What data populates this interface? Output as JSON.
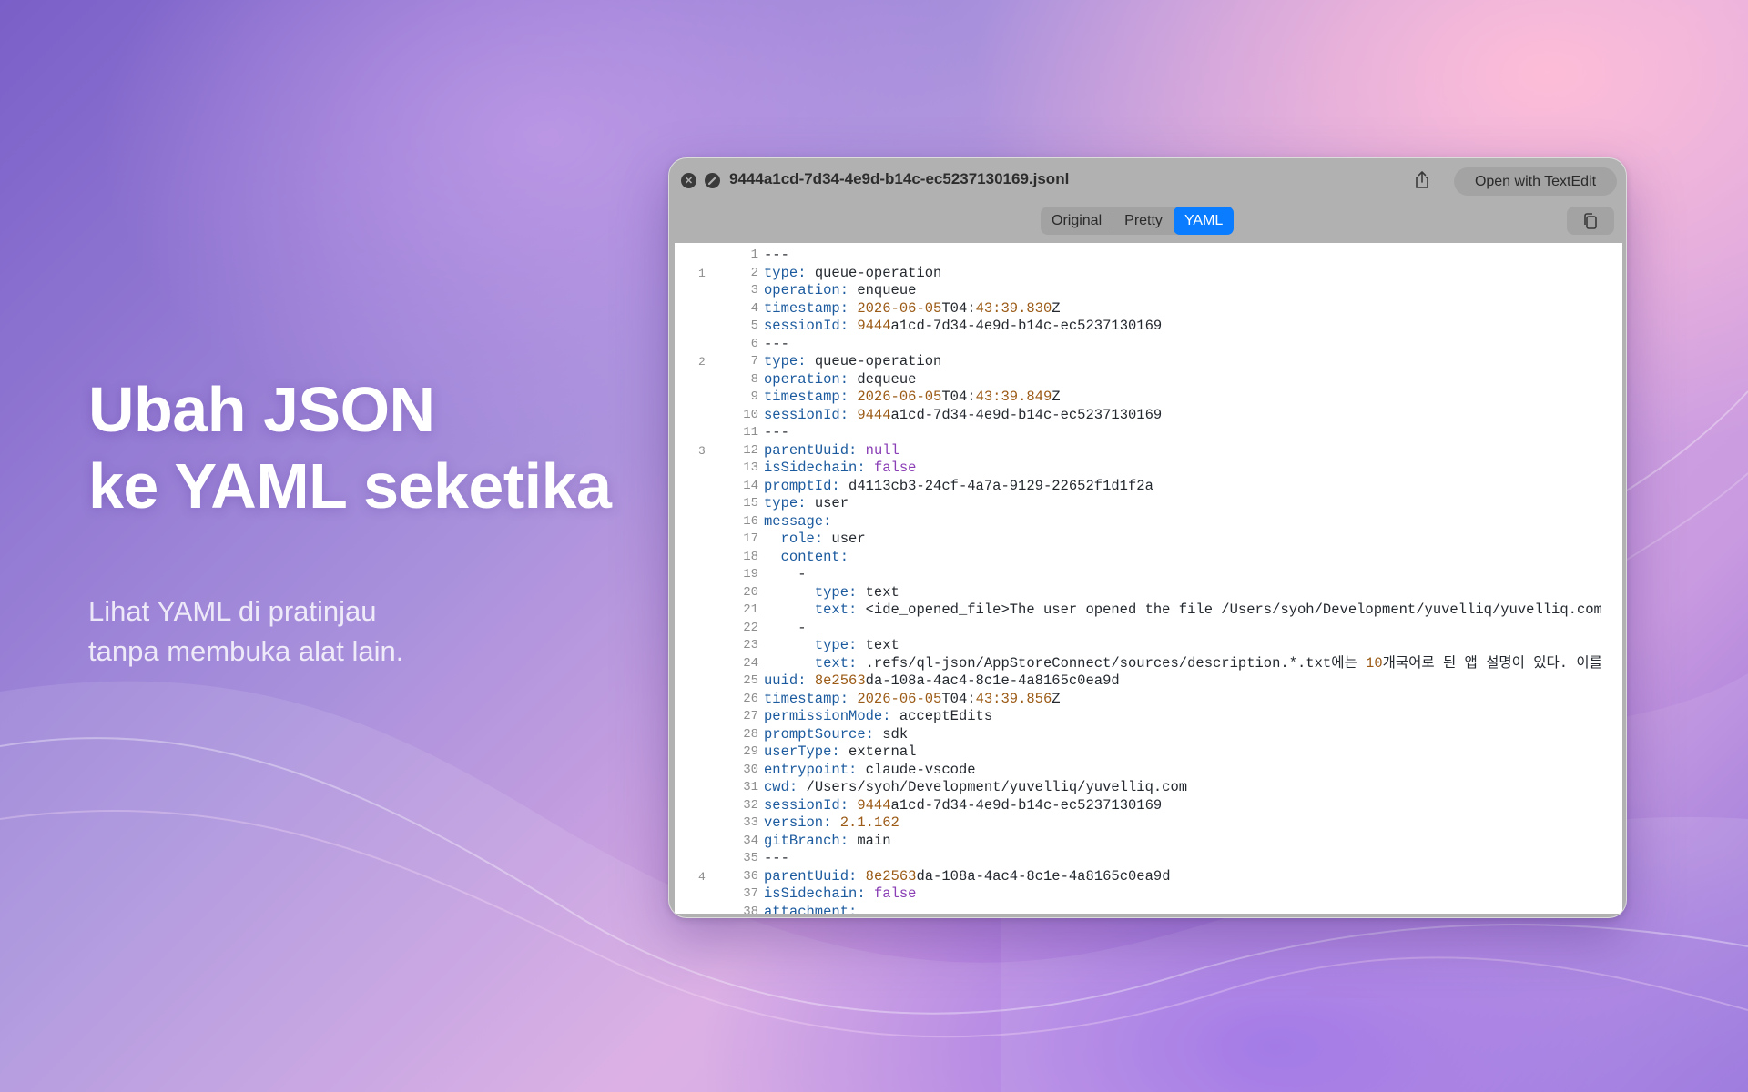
{
  "hero": {
    "title_line1": "Ubah JSON",
    "title_line2": "ke YAML seketika",
    "sub_line1": "Lihat YAML di pratinjau",
    "sub_line2": "tanpa membuka alat lain."
  },
  "window": {
    "filename": "9444a1cd-7d34-4e9d-b14c-ec5237130169.jsonl",
    "open_button": "Open with TextEdit",
    "tabs": [
      "Original",
      "Pretty",
      "YAML"
    ],
    "active_tab": "YAML"
  },
  "editor": {
    "lines": [
      {
        "n": "1",
        "rec": "",
        "t": [
          [
            "",
            "---"
          ]
        ]
      },
      {
        "n": "2",
        "rec": "1",
        "t": [
          [
            "k",
            "type:"
          ],
          [
            "",
            " queue-operation"
          ]
        ]
      },
      {
        "n": "3",
        "rec": "",
        "t": [
          [
            "k",
            "operation:"
          ],
          [
            "",
            " enqueue"
          ]
        ]
      },
      {
        "n": "4",
        "rec": "",
        "t": [
          [
            "k",
            "timestamp:"
          ],
          [
            "",
            " "
          ],
          [
            "n",
            "2026-06-05"
          ],
          [
            "",
            "T04:"
          ],
          [
            "n",
            "43:39.830"
          ],
          [
            "",
            "Z"
          ]
        ]
      },
      {
        "n": "5",
        "rec": "",
        "t": [
          [
            "k",
            "sessionId:"
          ],
          [
            "",
            " "
          ],
          [
            "n",
            "9444"
          ],
          [
            "",
            "a1cd-7d34-4e9d-b14c-ec5237130169"
          ]
        ]
      },
      {
        "n": "6",
        "rec": "",
        "t": [
          [
            "",
            "---"
          ]
        ]
      },
      {
        "n": "7",
        "rec": "2",
        "t": [
          [
            "k",
            "type:"
          ],
          [
            "",
            " queue-operation"
          ]
        ]
      },
      {
        "n": "8",
        "rec": "",
        "t": [
          [
            "k",
            "operation:"
          ],
          [
            "",
            " dequeue"
          ]
        ]
      },
      {
        "n": "9",
        "rec": "",
        "t": [
          [
            "k",
            "timestamp:"
          ],
          [
            "",
            " "
          ],
          [
            "n",
            "2026-06-05"
          ],
          [
            "",
            "T04:"
          ],
          [
            "n",
            "43:39.849"
          ],
          [
            "",
            "Z"
          ]
        ]
      },
      {
        "n": "10",
        "rec": "",
        "t": [
          [
            "k",
            "sessionId:"
          ],
          [
            "",
            " "
          ],
          [
            "n",
            "9444"
          ],
          [
            "",
            "a1cd-7d34-4e9d-b14c-ec5237130169"
          ]
        ]
      },
      {
        "n": "11",
        "rec": "",
        "t": [
          [
            "",
            "---"
          ]
        ]
      },
      {
        "n": "12",
        "rec": "3",
        "t": [
          [
            "k",
            "parentUuid:"
          ],
          [
            "",
            " "
          ],
          [
            "b",
            "null"
          ]
        ]
      },
      {
        "n": "13",
        "rec": "",
        "t": [
          [
            "k",
            "isSidechain:"
          ],
          [
            "",
            " "
          ],
          [
            "b",
            "false"
          ]
        ]
      },
      {
        "n": "14",
        "rec": "",
        "t": [
          [
            "k",
            "promptId:"
          ],
          [
            "",
            " d4113cb3-24cf-4a7a-9129-22652f1d1f2a"
          ]
        ]
      },
      {
        "n": "15",
        "rec": "",
        "t": [
          [
            "k",
            "type:"
          ],
          [
            "",
            " user"
          ]
        ]
      },
      {
        "n": "16",
        "rec": "",
        "t": [
          [
            "k",
            "message:"
          ]
        ]
      },
      {
        "n": "17",
        "rec": "",
        "t": [
          [
            "",
            "  "
          ],
          [
            "k",
            "role:"
          ],
          [
            "",
            " user"
          ]
        ]
      },
      {
        "n": "18",
        "rec": "",
        "t": [
          [
            "",
            "  "
          ],
          [
            "k",
            "content:"
          ]
        ]
      },
      {
        "n": "19",
        "rec": "",
        "t": [
          [
            "",
            "    -"
          ]
        ]
      },
      {
        "n": "20",
        "rec": "",
        "t": [
          [
            "",
            "      "
          ],
          [
            "k",
            "type:"
          ],
          [
            "",
            " text"
          ]
        ]
      },
      {
        "n": "21",
        "rec": "",
        "t": [
          [
            "",
            "      "
          ],
          [
            "k",
            "text:"
          ],
          [
            "",
            " <ide_opened_file>The user opened the file /Users/syoh/Development/yuvelliq/yuvelliq.com"
          ]
        ]
      },
      {
        "n": "22",
        "rec": "",
        "t": [
          [
            "",
            "    -"
          ]
        ]
      },
      {
        "n": "23",
        "rec": "",
        "t": [
          [
            "",
            "      "
          ],
          [
            "k",
            "type:"
          ],
          [
            "",
            " text"
          ]
        ]
      },
      {
        "n": "24",
        "rec": "",
        "t": [
          [
            "",
            "      "
          ],
          [
            "k",
            "text:"
          ],
          [
            "",
            " .refs/ql-json/AppStoreConnect/sources/description.*.txt에는 "
          ],
          [
            "n",
            "10"
          ],
          [
            "",
            "개국어로 된 앱 설명이 있다. 이를"
          ]
        ]
      },
      {
        "n": "25",
        "rec": "",
        "t": [
          [
            "k",
            "uuid:"
          ],
          [
            "",
            " "
          ],
          [
            "n",
            "8e2563"
          ],
          [
            "",
            "da-108a-4ac4-8c1e-4a8165c0ea9d"
          ]
        ]
      },
      {
        "n": "26",
        "rec": "",
        "t": [
          [
            "k",
            "timestamp:"
          ],
          [
            "",
            " "
          ],
          [
            "n",
            "2026-06-05"
          ],
          [
            "",
            "T04:"
          ],
          [
            "n",
            "43:39.856"
          ],
          [
            "",
            "Z"
          ]
        ]
      },
      {
        "n": "27",
        "rec": "",
        "t": [
          [
            "k",
            "permissionMode:"
          ],
          [
            "",
            " acceptEdits"
          ]
        ]
      },
      {
        "n": "28",
        "rec": "",
        "t": [
          [
            "k",
            "promptSource:"
          ],
          [
            "",
            " sdk"
          ]
        ]
      },
      {
        "n": "29",
        "rec": "",
        "t": [
          [
            "k",
            "userType:"
          ],
          [
            "",
            " external"
          ]
        ]
      },
      {
        "n": "30",
        "rec": "",
        "t": [
          [
            "k",
            "entrypoint:"
          ],
          [
            "",
            " claude-vscode"
          ]
        ]
      },
      {
        "n": "31",
        "rec": "",
        "t": [
          [
            "k",
            "cwd:"
          ],
          [
            "",
            " /Users/syoh/Development/yuvelliq/yuvelliq.com"
          ]
        ]
      },
      {
        "n": "32",
        "rec": "",
        "t": [
          [
            "k",
            "sessionId:"
          ],
          [
            "",
            " "
          ],
          [
            "n",
            "9444"
          ],
          [
            "",
            "a1cd-7d34-4e9d-b14c-ec5237130169"
          ]
        ]
      },
      {
        "n": "33",
        "rec": "",
        "t": [
          [
            "k",
            "version:"
          ],
          [
            "",
            " "
          ],
          [
            "n",
            "2.1.162"
          ]
        ]
      },
      {
        "n": "34",
        "rec": "",
        "t": [
          [
            "k",
            "gitBranch:"
          ],
          [
            "",
            " main"
          ]
        ]
      },
      {
        "n": "35",
        "rec": "",
        "t": [
          [
            "",
            "---"
          ]
        ]
      },
      {
        "n": "36",
        "rec": "4",
        "t": [
          [
            "k",
            "parentUuid:"
          ],
          [
            "",
            " "
          ],
          [
            "n",
            "8e2563"
          ],
          [
            "",
            "da-108a-4ac4-8c1e-4a8165c0ea9d"
          ]
        ]
      },
      {
        "n": "37",
        "rec": "",
        "t": [
          [
            "k",
            "isSidechain:"
          ],
          [
            "",
            " "
          ],
          [
            "b",
            "false"
          ]
        ]
      },
      {
        "n": "38",
        "rec": "",
        "t": [
          [
            "k",
            "attachment:"
          ]
        ]
      }
    ]
  }
}
